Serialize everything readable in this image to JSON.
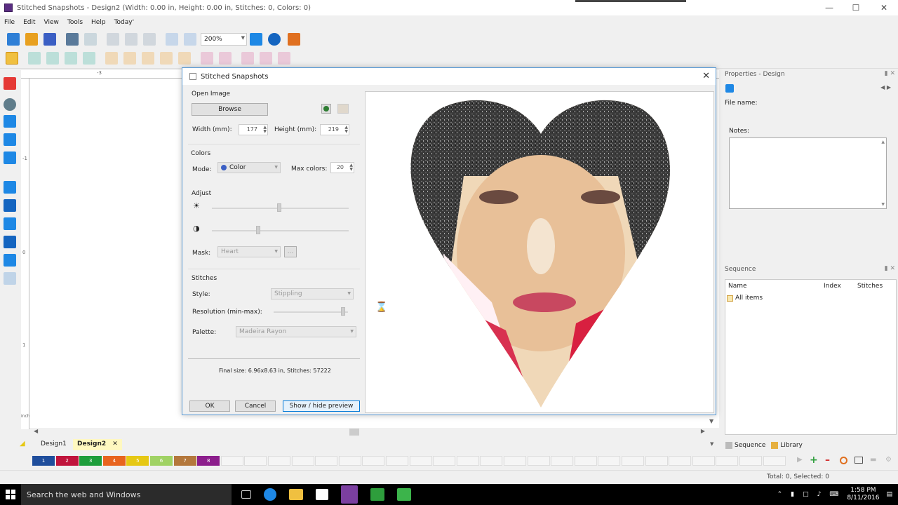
{
  "window": {
    "title": "Stitched Snapshots - Design2 (Width: 0.00 in, Height: 0.00 in, Stitches: 0, Colors: 0)"
  },
  "menu": [
    "File",
    "Edit",
    "View",
    "Tools",
    "Help",
    "Today'"
  ],
  "toolbar": {
    "zoom": "200%"
  },
  "ruler": {
    "top_mark": "-3",
    "left_mark_1": "-1",
    "left_mark_2": "0",
    "left_mark_3": "1",
    "unit": "inches"
  },
  "dialog": {
    "title": "Stitched Snapshots",
    "open_image": {
      "section": "Open Image",
      "browse_label": "Browse",
      "width_label": "Width (mm):",
      "width_value": "177",
      "height_label": "Height (mm):",
      "height_value": "219"
    },
    "colors": {
      "section": "Colors",
      "mode_label": "Mode:",
      "mode_value": "Color",
      "max_colors_label": "Max colors:",
      "max_colors_value": "20"
    },
    "adjust": {
      "section": "Adjust",
      "brightness": 0.49,
      "contrast": 0.34,
      "mask_label": "Mask:",
      "mask_value": "Heart",
      "mask_more": "..."
    },
    "stitches": {
      "section": "Stitches",
      "style_label": "Style:",
      "style_value": "Stippling",
      "resolution_label": "Resolution (min-max):",
      "resolution": 0.93,
      "palette_label": "Palette:",
      "palette_value": "Madeira Rayon"
    },
    "final_size": "Final size: 6.96x8.63 in, Stitches: 57222",
    "buttons": {
      "ok": "OK",
      "cancel": "Cancel",
      "preview": "Show / hide preview"
    }
  },
  "properties": {
    "header": "Properties - Design",
    "file_name_label": "File name:",
    "notes_label": "Notes:"
  },
  "sequence": {
    "header": "Sequence",
    "columns": [
      "Name",
      "Index",
      "Stitches"
    ],
    "items": [
      "All items"
    ]
  },
  "design_tabs": [
    "Design1",
    "Design2"
  ],
  "panel_tabs": [
    "Sequence",
    "Library"
  ],
  "palette": [
    {
      "num": "1",
      "color": "#1f4e9c"
    },
    {
      "num": "2",
      "color": "#c0143c"
    },
    {
      "num": "3",
      "color": "#1e9e3c"
    },
    {
      "num": "4",
      "color": "#e8641e"
    },
    {
      "num": "5",
      "color": "#e6c814"
    },
    {
      "num": "6",
      "color": "#a0d264"
    },
    {
      "num": "7",
      "color": "#b4783c"
    },
    {
      "num": "8",
      "color": "#8c1e8c"
    }
  ],
  "status": {
    "text": "Total: 0, Selected: 0"
  },
  "taskbar": {
    "search_placeholder": "Search the web and Windows",
    "time": "1:58 PM",
    "date": "8/11/2016"
  },
  "colors": {
    "accent": "#0078d7",
    "selection": "#5b9bd5"
  }
}
